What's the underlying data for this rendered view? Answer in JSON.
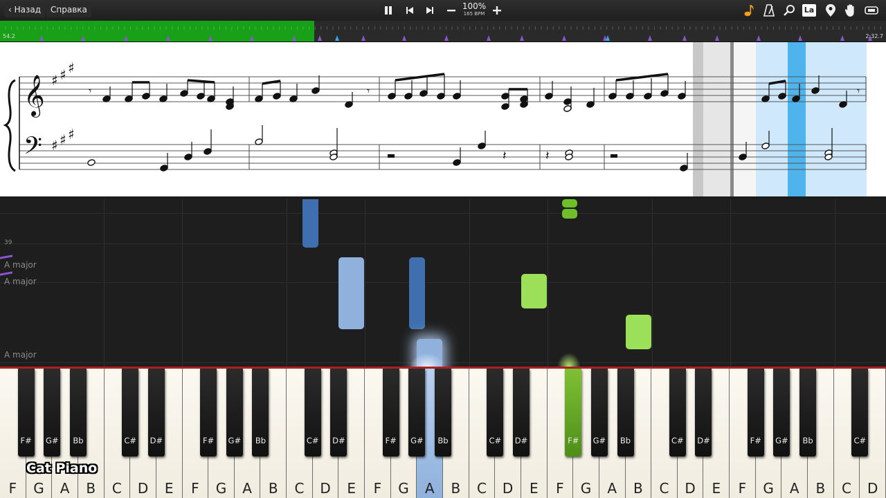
{
  "toolbar": {
    "back_label": "Назад",
    "help_label": "Справка",
    "zoom": "100%",
    "bpm": "165 BPM",
    "icons": [
      "pause-icon",
      "skip-back-icon",
      "skip-forward-icon",
      "minus-icon",
      "plus-icon",
      "note-icon",
      "metronome-icon",
      "search-icon",
      "la-icon",
      "pin-icon",
      "hand-icon",
      "loop-icon"
    ],
    "la_label": "La"
  },
  "progress": {
    "current_time": "54.2",
    "total_time": "2:32.7",
    "fraction": 0.355
  },
  "roll": {
    "measure_number": "39",
    "key_labels": [
      "A major",
      "A major",
      "A major"
    ]
  },
  "keyboard": {
    "white_keys": [
      "F",
      "G",
      "A",
      "B",
      "C",
      "D",
      "E",
      "F",
      "G",
      "A",
      "B",
      "C",
      "D",
      "E",
      "F",
      "G",
      "A",
      "B",
      "C",
      "D",
      "E",
      "F",
      "G",
      "A",
      "B",
      "C",
      "D",
      "E",
      "F",
      "G",
      "A",
      "B",
      "C",
      "D"
    ],
    "black_keys": [
      "F#",
      "G#",
      "Bb",
      "C#",
      "D#",
      "F#",
      "G#",
      "Bb",
      "C#",
      "D#",
      "F#",
      "G#",
      "Bb",
      "C#",
      "D#",
      "F#",
      "G#",
      "Bb",
      "C#",
      "D#",
      "F#",
      "G#",
      "Bb",
      "C#"
    ],
    "active_white": "A",
    "active_black": "F#"
  },
  "logo": "Cat Piano",
  "colors": {
    "progress_green": "#18a018",
    "left_hand_blue": "#8fb1dc",
    "left_hand_dark": "#3f6fae",
    "right_hand_green": "#9ce05a",
    "accent_red": "#b02020"
  }
}
